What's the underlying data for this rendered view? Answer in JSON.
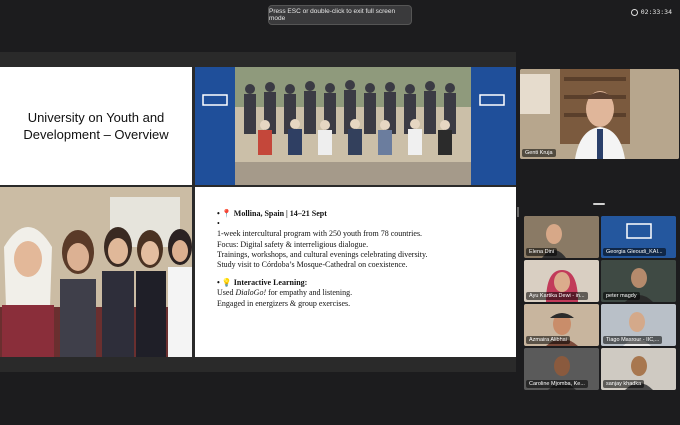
{
  "banner": {
    "text": "Press ESC or double-click to exit full screen mode"
  },
  "clock": {
    "time": "02:33:34"
  },
  "slide": {
    "title": "University on Youth and Development – Overview",
    "location_heading": "Mollina, Spain | 14–21 Sept",
    "bullets_1": [
      "1-week intercultural program with 250 youth from 78 countries.",
      "Focus: Digital safety & interreligious dialogue.",
      "Trainings, workshops, and cultural evenings celebrating diversity.",
      "Study visit to Córdoba’s Mosque-Cathedral on coexistence."
    ],
    "learning_heading": "Interactive Learning:",
    "bullets_2_prefix": "Used ",
    "bullets_2_em": "DialoGo!",
    "bullets_2_suffix": " for empathy and listening.",
    "bullets_2_b": "Engaged in energizers & group exercises."
  },
  "participants": {
    "main": "Genti Kruja",
    "tiles": [
      "Elena Dini",
      "Georgia Gleoudi_KAI...",
      "Ayu Kartika Dewi - in...",
      "peter magdy",
      "Azmaira Alibhai",
      "Tiago Masrour - IIC,...",
      "Caroline Mjomba, Ke...",
      "sanjay khadka"
    ]
  },
  "colors": {
    "brand_blue": "#1f4f9a",
    "accent_red": "#d8314a"
  }
}
